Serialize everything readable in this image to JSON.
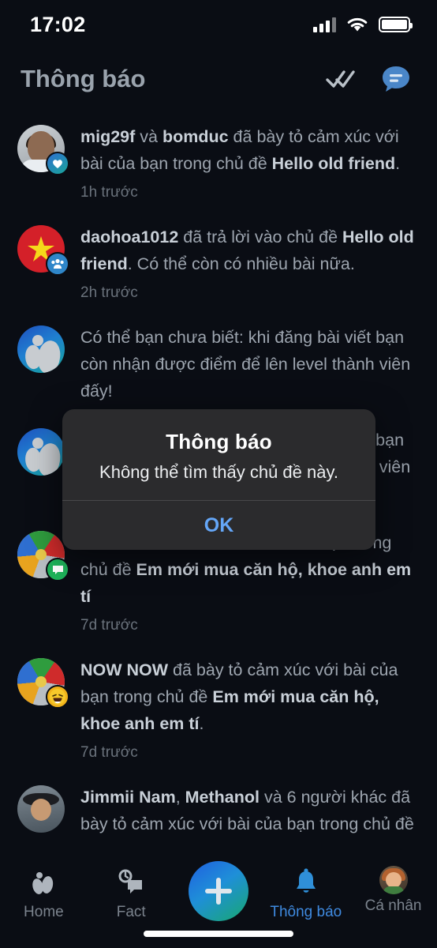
{
  "status_bar": {
    "time": "17:02",
    "signal_icon": "signal-bars-icon",
    "wifi_icon": "wifi-icon",
    "battery_icon": "battery-full-icon"
  },
  "header": {
    "title": "Thông báo",
    "mark_all_read_icon": "double-check-icon",
    "chat_icon": "chat-bubble-icon"
  },
  "notifications": [
    {
      "avatar": "photo-man",
      "badge": "heart-icon",
      "time": "1h trước",
      "parts": [
        {
          "t": "mig29f",
          "b": true
        },
        {
          "t": " và ",
          "b": false
        },
        {
          "t": "bomduc",
          "b": true
        },
        {
          "t": " đã bày tỏ cảm xúc với bài của bạn trong chủ đề ",
          "b": false
        },
        {
          "t": "Hello old friend",
          "b": true
        },
        {
          "t": ".",
          "b": false
        }
      ]
    },
    {
      "avatar": "vietnam-flag",
      "badge": "group-icon",
      "time": "2h trước",
      "parts": [
        {
          "t": "daohoa1012",
          "b": true
        },
        {
          "t": " đã trả lời vào chủ đề ",
          "b": false
        },
        {
          "t": "Hello old friend",
          "b": true
        },
        {
          "t": ". Có thể còn có nhiều bài nữa.",
          "b": false
        }
      ]
    },
    {
      "avatar": "app-logo",
      "badge": "",
      "time": "",
      "parts": [
        {
          "t": "Có thể bạn chưa biết: khi đăng bài viết bạn còn nhận được điểm để lên level thành viên đấy!",
          "b": false
        }
      ]
    },
    {
      "avatar": "app-logo",
      "badge": "",
      "time": "",
      "parts": [
        {
          "t": "Có thể bạn chưa biết: khi đăng bài viết bạn còn nhận được điểm để lên level thành viên đấy!",
          "b": false
        }
      ]
    },
    {
      "avatar": "beach-ball",
      "badge": "comment-icon",
      "time": "7d trước",
      "parts": [
        {
          "t": "NOW NOW",
          "b": true
        },
        {
          "t": " đã dẫn bài viết của bạn trong chủ đề ",
          "b": false
        },
        {
          "t": "Em mới mua căn hộ, khoe anh em tí",
          "b": true
        }
      ]
    },
    {
      "avatar": "beach-ball",
      "badge": "laugh-emoji-icon",
      "time": "7d trước",
      "parts": [
        {
          "t": "NOW NOW",
          "b": true
        },
        {
          "t": " đã bày tỏ cảm xúc với bài của bạn trong chủ đề ",
          "b": false
        },
        {
          "t": "Em mới mua căn hộ, khoe anh em tí",
          "b": true
        },
        {
          "t": ".",
          "b": false
        }
      ]
    },
    {
      "avatar": "kid-photo",
      "badge": "",
      "time": "",
      "parts": [
        {
          "t": "Jimmii Nam",
          "b": true
        },
        {
          "t": ", ",
          "b": false
        },
        {
          "t": "Methanol",
          "b": true
        },
        {
          "t": " và 6 người khác đã bày tỏ cảm xúc với bài của bạn trong chủ đề",
          "b": false
        }
      ]
    }
  ],
  "dialog": {
    "title": "Thông báo",
    "message": "Không thể tìm thấy chủ đề này.",
    "ok_label": "OK"
  },
  "tabbar": {
    "items": [
      {
        "label": "Home",
        "icon": "leaf-home-icon",
        "active": false
      },
      {
        "label": "Fact",
        "icon": "fact-chat-icon",
        "active": false
      },
      {
        "label": "",
        "icon": "plus-fab-icon",
        "active": false
      },
      {
        "label": "Thông báo",
        "icon": "bell-icon",
        "active": true
      },
      {
        "label": "Cá nhân",
        "icon": "profile-avatar-icon",
        "active": false
      }
    ]
  },
  "colors": {
    "background": "#0a0d14",
    "accent": "#3f8ae0",
    "dialog_bg": "#2b2b2d",
    "ok_blue": "#64a6f7"
  }
}
